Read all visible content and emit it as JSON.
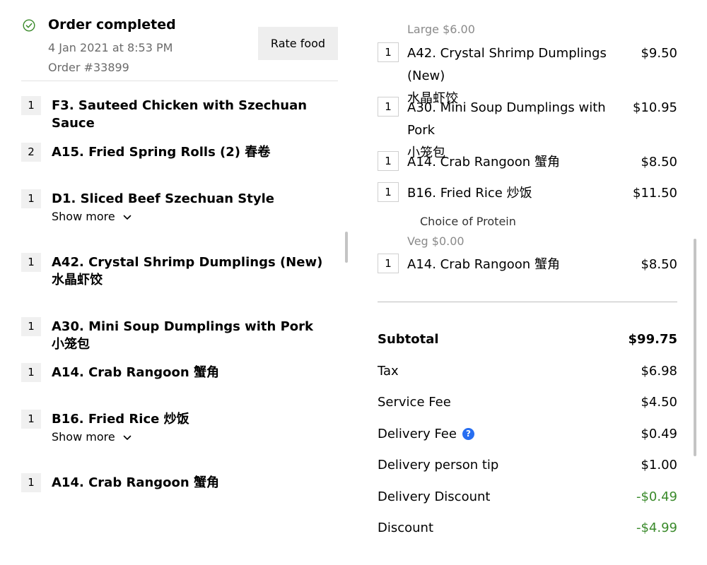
{
  "order": {
    "status": "Order completed",
    "date": "4 Jan 2021 at 8:53 PM",
    "number": "Order #33899",
    "rate_label": "Rate food"
  },
  "left_items": [
    {
      "qty": "1",
      "name": "F3. Sauteed Chicken with Szechuan Sauce"
    },
    {
      "qty": "2",
      "name": "A15. Fried Spring Rolls (2) 春卷"
    },
    {
      "qty": "1",
      "name": "D1. Sliced Beef Szechuan Style",
      "show_more": "Show more"
    },
    {
      "qty": "1",
      "name": "A42. Crystal Shrimp Dumplings (New) 水晶虾饺"
    },
    {
      "qty": "1",
      "name": "A30. Mini Soup Dumplings with Pork 小笼包"
    },
    {
      "qty": "1",
      "name": "A14. Crab Rangoon 蟹角"
    },
    {
      "qty": "1",
      "name": "B16. Fried Rice 炒饭",
      "show_more": "Show more"
    },
    {
      "qty": "1",
      "name": "A14. Crab Rangoon 蟹角"
    }
  ],
  "receipt": {
    "top_option": "Large $6.00",
    "items": [
      {
        "qty": "1",
        "name_line1": "A42. Crystal Shrimp Dumplings (New)",
        "name_line2": "水晶虾饺",
        "price": "$9.50"
      },
      {
        "qty": "1",
        "name_line1": "A30. Mini Soup Dumplings with Pork",
        "name_line2": "小笼包",
        "price": "$10.95"
      },
      {
        "qty": "1",
        "name_line1": "A14. Crab Rangoon 蟹角",
        "price": "$8.50"
      },
      {
        "qty": "1",
        "name_line1": "B16. Fried Rice 炒饭",
        "price": "$11.50"
      },
      {
        "qty": "1",
        "name_line1": "A14. Crab Rangoon 蟹角",
        "price": "$8.50"
      }
    ],
    "option_title": "Choice of Protein",
    "option_value": "Veg $0.00"
  },
  "totals": {
    "subtotal_label": "Subtotal",
    "subtotal": "$99.75",
    "tax_label": "Tax",
    "tax": "$6.98",
    "service_fee_label": "Service Fee",
    "service_fee": "$4.50",
    "delivery_fee_label": "Delivery Fee",
    "delivery_fee": "$0.49",
    "tip_label": "Delivery person tip",
    "tip": "$1.00",
    "delivery_discount_label": "Delivery Discount",
    "delivery_discount": "-$0.49",
    "discount_label": "Discount",
    "discount": "-$4.99"
  },
  "colors": {
    "discount_green": "#3a8a2b",
    "help_blue": "#276ef1",
    "check_green": "#3a8a2b"
  },
  "icons": {
    "status": "check-circle-icon",
    "help": "question-circle-icon",
    "expand": "chevron-down-icon"
  }
}
